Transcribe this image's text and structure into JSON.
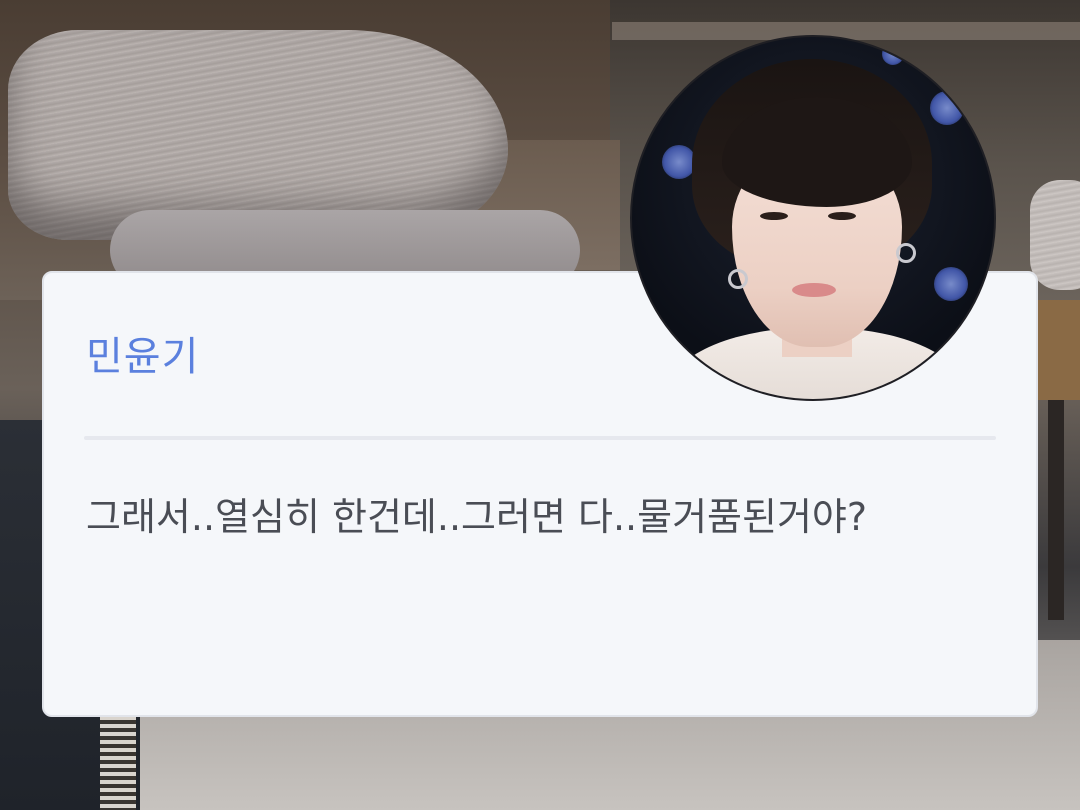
{
  "dialog": {
    "speaker_name": "민윤기",
    "message": "그래서..열심히 한건데..그러면 다..물거품된거야?"
  },
  "colors": {
    "speaker_name": "#5b80de",
    "message_text": "#4a4d55",
    "dialog_background": "#f5f7fa",
    "divider": "#e6e8ee"
  },
  "icons": {
    "avatar": "character-portrait"
  }
}
